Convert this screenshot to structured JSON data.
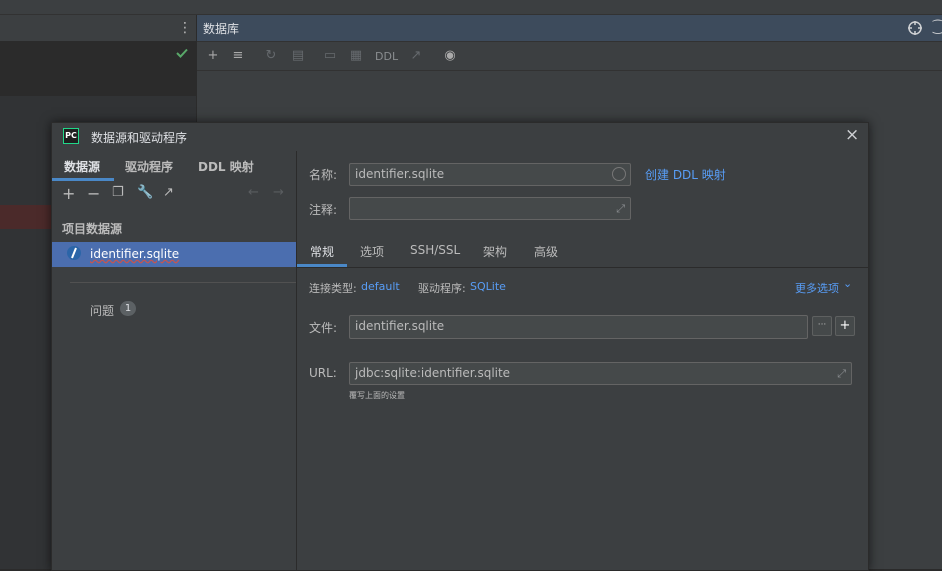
{
  "db_panel": {
    "title": "数据库",
    "toolbar_ddl": "DDL"
  },
  "dialog": {
    "title": "数据源和驱动程序",
    "left_tabs": [
      "数据源",
      "驱动程序",
      "DDL 映射"
    ],
    "section_title": "项目数据源",
    "datasource": {
      "name": "identifier.sqlite"
    },
    "problems": {
      "label": "问题",
      "count": "1"
    }
  },
  "form": {
    "name_label": "名称:",
    "name_value": "identifier.sqlite",
    "create_ddl_link": "创建 DDL 映射",
    "comment_label": "注释:",
    "comment_value": "",
    "sub_tabs": [
      "常规",
      "选项",
      "SSH/SSL",
      "架构",
      "高级"
    ],
    "conn_type_label": "连接类型:",
    "conn_type_value": "default",
    "driver_label": "驱动程序:",
    "driver_value": "SQLite",
    "more_options": "更多选项",
    "file_label": "文件:",
    "file_value": "identifier.sqlite",
    "url_label": "URL:",
    "url_value": "jdbc:sqlite:identifier.sqlite",
    "url_hint": "覆写上面的设置"
  },
  "colors": {
    "accent": "#4a88c7",
    "link": "#589df6",
    "selected_row": "#4b6eaf",
    "status_ok": "#59a869"
  }
}
